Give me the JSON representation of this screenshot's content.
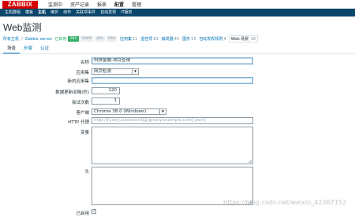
{
  "logo": "ZABBIX",
  "top_menu": [
    "监测中",
    "资产记录",
    "报表",
    "配置",
    "管理"
  ],
  "top_menu_active": 3,
  "sub_menu": [
    "主机群组",
    "模板",
    "主机",
    "维护",
    "动作",
    "关联项事件",
    "自动发现",
    "IT服务"
  ],
  "sub_menu_active": 2,
  "page_title": "Web监测",
  "breadcrumb": {
    "all_hosts": "所有主机",
    "sep": "/",
    "host": "Zabbix server",
    "enabled": "已启用",
    "badges": [
      "ZBX",
      "SNMP",
      "JMX",
      "IPMI"
    ],
    "apps_label": "应用集",
    "apps_count": "11",
    "items_label": "监控项",
    "items_count": "83",
    "triggers_label": "触发器",
    "triggers_count": "45",
    "graphs_label": "图形",
    "graphs_count": "15",
    "discovery_label": "自动发现规则",
    "discovery_count": "4",
    "web_label": "Web 场景",
    "web_count": "16"
  },
  "tabs": [
    "场景",
    "步骤",
    "认证"
  ],
  "form": {
    "name_label": "名称",
    "name_value": "科技金融-项目查询",
    "app_label": "应用集",
    "app_value": "网页检测",
    "new_app_label": "新的应用集",
    "new_app_value": "",
    "interval_label": "数据更新间隔(秒)",
    "interval_value": "120",
    "attempts_label": "尝试次数",
    "attempts_value": "1",
    "agent_label": "客户端",
    "agent_value": "Chrome 38.0 (Windows)",
    "proxy_label": "HTTP 代理",
    "proxy_placeholder": "http://[user[:password]@]proxy.example.com[:port]",
    "variables_label": "变量",
    "headers_label": "头",
    "enabled_label": "已启用",
    "enabled_checked": "✓"
  },
  "watermark": "https://blog.csdn.net/weixin_42267152",
  "colors": {
    "brand": "#d40000",
    "nav": "#0a466a",
    "link": "#0275b8",
    "green": "#34af67"
  }
}
